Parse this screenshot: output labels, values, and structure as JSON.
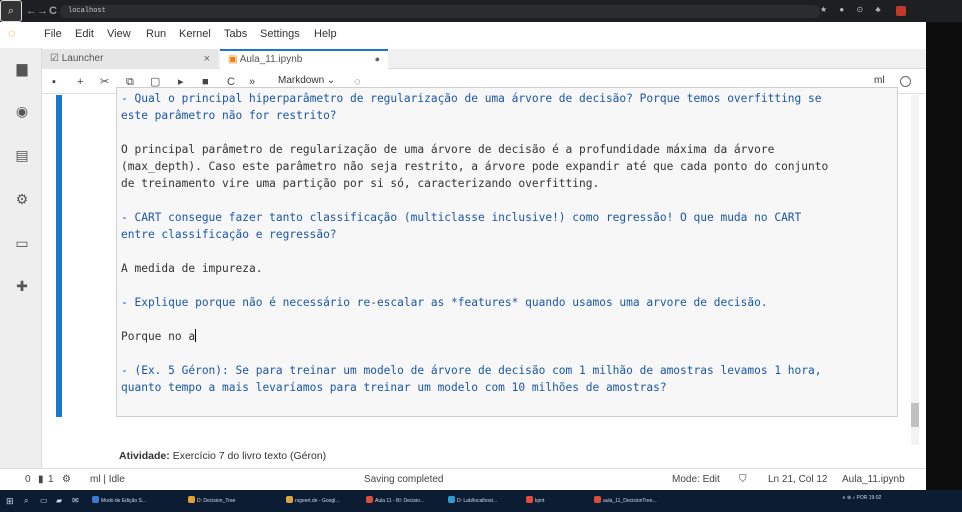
{
  "browser": {
    "url": "localhost",
    "back_icon": "←",
    "forward_icon": "→",
    "reload_icon": "C",
    "right_icons": "★ ● ⊙ ♣"
  },
  "menu": [
    "File",
    "Edit",
    "View",
    "Run",
    "Kernel",
    "Tabs",
    "Settings",
    "Help"
  ],
  "tabs": [
    {
      "label": "Launcher",
      "close": "×"
    },
    {
      "label": "Aula_11.ipynb",
      "close": "●"
    }
  ],
  "toolbar": {
    "cell_type": "Markdown ⌄",
    "kernel": "ml"
  },
  "cell_lines": [
    {
      "text": "- Qual o principal hiperparâmetro de regularização de uma árvore de decisão? Porque temos overfitting se",
      "type": "md"
    },
    {
      "text": "este parâmetro não for restrito?",
      "type": "md"
    },
    {
      "text": "",
      "type": "plain"
    },
    {
      "text": "O principal parâmetro de regularização de uma árvore de decisão é a profundidade máxima da árvore",
      "type": "plain"
    },
    {
      "text": "(max_depth). Caso este parâmetro não seja restrito, a árvore pode expandir até que cada ponto do conjunto",
      "type": "plain"
    },
    {
      "text": "de treinamento vire uma partição por si só, caracterizando overfitting.",
      "type": "plain"
    },
    {
      "text": "",
      "type": "plain"
    },
    {
      "text": "- CART consegue fazer tanto classificação (multiclasse inclusive!) como regressão! O que muda no CART",
      "type": "md"
    },
    {
      "text": "entre classificação e regressão?",
      "type": "md"
    },
    {
      "text": "",
      "type": "plain"
    },
    {
      "text": "A medida de impureza.",
      "type": "plain"
    },
    {
      "text": "",
      "type": "plain"
    },
    {
      "text": "- Explique porque não é necessário re-escalar as *features* quando usamos uma arvore de decisão.",
      "type": "md"
    },
    {
      "text": "",
      "type": "plain"
    },
    {
      "text": "Porque no a",
      "type": "caret"
    },
    {
      "text": "",
      "type": "plain"
    },
    {
      "text": "- (Ex. 5 Géron): Se para treinar um modelo de árvore de decisão com 1 milhão de amostras levamos 1 hora,",
      "type": "md"
    },
    {
      "text": "quanto tempo a mais levaríamos para treinar um modelo com 10 milhões de amostras?",
      "type": "md"
    }
  ],
  "activity": {
    "label": "Atividade:",
    "text": "Exercício 7 do livro texto (Géron)"
  },
  "status": {
    "left_a": "0",
    "left_b": "1",
    "kernel_state": "ml | Idle",
    "center": "Saving completed",
    "mode": "Mode: Edit",
    "position": "Ln 21, Col 12",
    "file": "Aula_11.ipynb"
  },
  "taskbar": {
    "items": [
      {
        "label": "Modo de Edição S...",
        "color": "#3b7bd6"
      },
      {
        "label": "D: Decision_Tree",
        "color": "#e0a030"
      },
      {
        "label": "rsgeert.de - Googl...",
        "color": "#d8a640"
      },
      {
        "label": "Aula 11 - BI: Decisio...",
        "color": "#d84f3b"
      },
      {
        "label": "D: Lab/localhost...",
        "color": "#2f9bd1"
      },
      {
        "label": "kpnt",
        "color": "#e34d3c"
      },
      {
        "label": "aula_11_DecisionTree...",
        "color": "#d84f3b"
      }
    ],
    "tray": "∧ ⊕ ♪ POR 19:02"
  }
}
